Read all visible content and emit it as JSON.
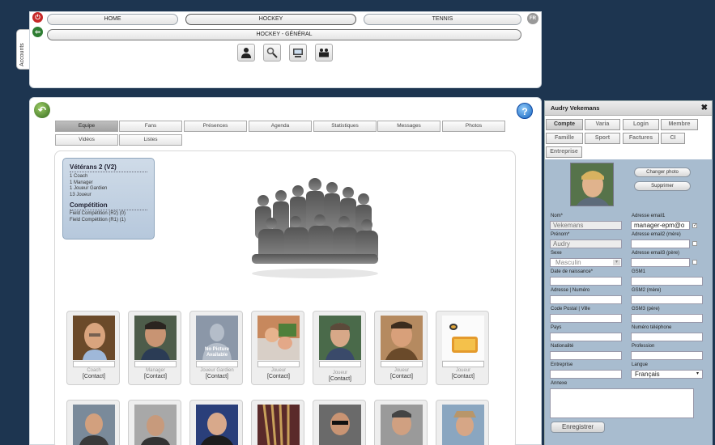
{
  "accounts_tab": "Accounts",
  "lang_badge": "FR",
  "nav": {
    "home": "HOME",
    "hockey": "HOCKEY",
    "tennis": "TENNIS",
    "sub": "HOCKEY - GÉNÉRAL"
  },
  "tools": [
    "person-icon",
    "search-icon",
    "monitor-icon",
    "group-icon"
  ],
  "tabs": [
    "Equipe",
    "Fans",
    "Présences",
    "Agenda",
    "Statistiques",
    "Messages",
    "Photos",
    "Vidéos",
    "Listes"
  ],
  "team": {
    "title": "Vétérans 2 (V2)",
    "roles": [
      "1 Coach",
      "1 Manager",
      "1 Joueur Gardien",
      "13 Joueur"
    ],
    "competition_title": "Compétition",
    "competitions": [
      "Field Compétition (R2) (0)",
      "Field Compétition (R1) (1)"
    ]
  },
  "members_row1": [
    {
      "role": "Coach",
      "contact": "[Contact]"
    },
    {
      "role": "Manager",
      "contact": "[Contact]"
    },
    {
      "role": "Joueur Gardien",
      "contact": "[Contact]",
      "placeholder": "No Picture Available"
    },
    {
      "role": "Joueur",
      "contact": "[Contact]"
    },
    {
      "role": "Joueur",
      "contact": "[Contact]"
    },
    {
      "role": "Joueur",
      "contact": "[Contact]"
    },
    {
      "role": "Joueur",
      "contact": "[Contact]"
    }
  ],
  "panel": {
    "title": "Audry Vekemans",
    "close": "✖",
    "tabs": [
      "Compte",
      "Varia",
      "Login",
      "Membre",
      "Famille",
      "Sport",
      "Factures",
      "CI",
      "Entreprise"
    ],
    "change_photo": "Changer photo",
    "delete": "Supprimer",
    "labels": {
      "nom": "Nom*",
      "prenom": "Prénom*",
      "sexe": "Sexe",
      "naissance": "Date de naissance*",
      "adresse": "Adresse | Numéro",
      "cp": "Code Postal | Ville",
      "pays": "Pays",
      "nationalite": "Nationalité",
      "entreprise": "Entreprise",
      "annexe": "Annexe",
      "email1": "Adresse email1",
      "email2": "Adresse email2 (mère)",
      "email3": "Adresse email3 (père)",
      "gsm1": "GSM1",
      "gsm2": "GSM2 (mère)",
      "gsm3": "GSM3 (père)",
      "tel": "Numéro téléphone",
      "profession": "Profession",
      "langue": "Langue"
    },
    "values": {
      "nom": "Vekemans",
      "prenom": "Audry",
      "sexe": "Masculin",
      "email1": "manager-epm@o",
      "langue": "Français"
    },
    "save": "Enregistrer"
  }
}
